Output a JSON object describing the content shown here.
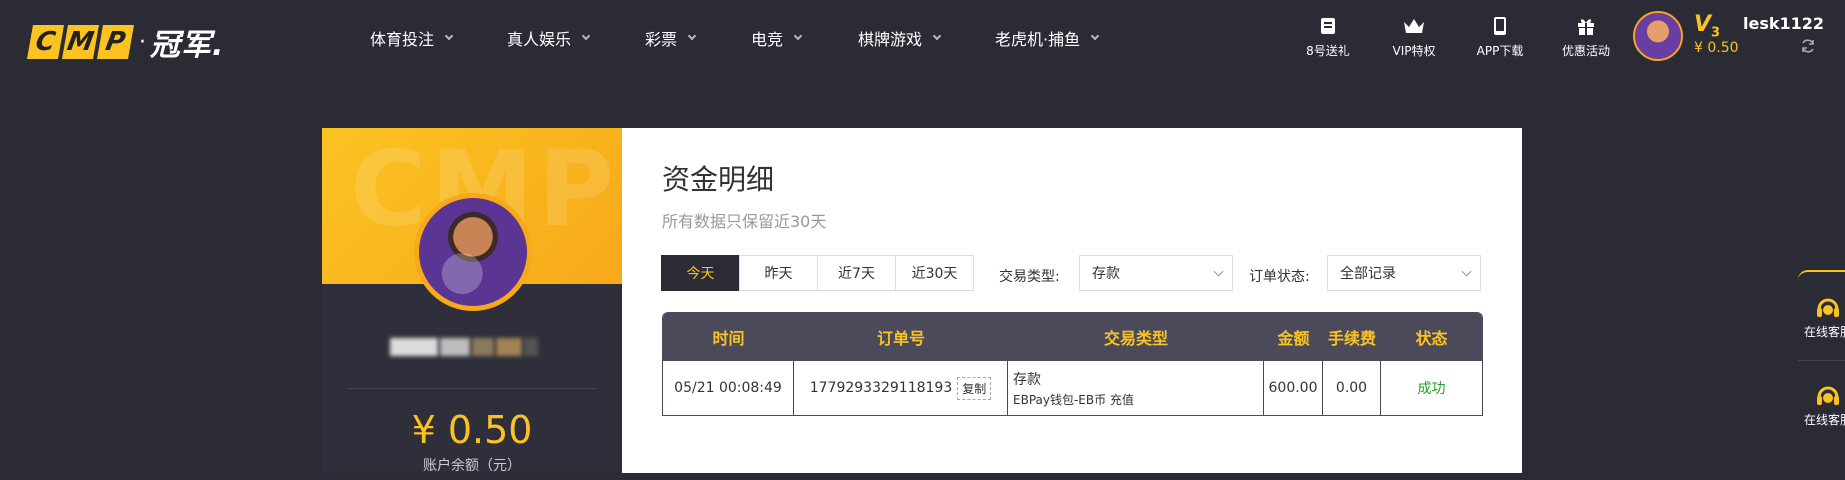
{
  "logo": {
    "letters": [
      "C",
      "M",
      "P"
    ],
    "dot": "·",
    "cn": "冠军."
  },
  "nav": [
    {
      "label": "体育投注"
    },
    {
      "label": "真人娱乐"
    },
    {
      "label": "彩票"
    },
    {
      "label": "电竞"
    },
    {
      "label": "棋牌游戏"
    },
    {
      "label": "老虎机·捕鱼"
    }
  ],
  "tools": [
    {
      "label": "8号送礼",
      "icon": "ticket-icon"
    },
    {
      "label": "VIP特权",
      "icon": "crown-icon"
    },
    {
      "label": "APP下载",
      "icon": "tablet-icon"
    },
    {
      "label": "优惠活动",
      "icon": "gift-icon"
    }
  ],
  "user": {
    "vip": "V",
    "vip_level": "3",
    "balance": "¥ 0.50",
    "username": "lesk1122"
  },
  "side": {
    "watermark": "CMP",
    "balance": "¥ 0.50",
    "balance_label": "账户余额（元）"
  },
  "main": {
    "title": "资金明细",
    "subtitle": "所有数据只保留近30天",
    "date_tabs": [
      "今天",
      "昨天",
      "近7天",
      "近30天"
    ],
    "type_label": "交易类型:",
    "type_value": "存款",
    "status_label": "订单状态:",
    "status_value": "全部记录",
    "columns": [
      "时间",
      "订单号",
      "交易类型",
      "金额",
      "手续费",
      "状态"
    ],
    "rows": [
      {
        "time": "05/21 00:08:49",
        "order": "1779293329118193",
        "copy": "复制",
        "type": "存款",
        "type_detail": "EBPay钱包-EB币 充值",
        "amount": "600.00",
        "fee": "0.00",
        "status": "成功"
      }
    ]
  },
  "float_panel": [
    {
      "label": "在线客服"
    },
    {
      "label": "在线客服"
    }
  ],
  "colors": {
    "accent": "#fbc322",
    "dark": "#2b2b36",
    "header": "#4a4a5a",
    "success": "#23a023"
  }
}
